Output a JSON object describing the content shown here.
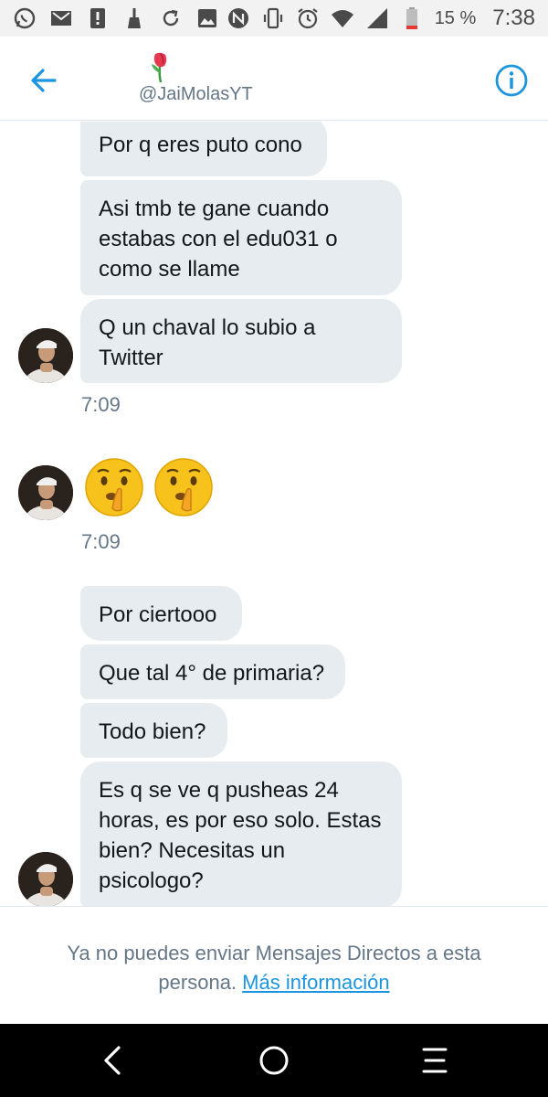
{
  "status_bar": {
    "battery_percent": "15 %",
    "time": "7:38",
    "left_icons": [
      "whatsapp-icon",
      "gmail-icon",
      "alert-icon",
      "broom-icon",
      "sync-icon",
      "gallery-icon"
    ],
    "right_icons": [
      "nfc-icon",
      "vibrate-icon",
      "alarm-icon",
      "wifi-icon",
      "signal-icon",
      "battery-icon"
    ]
  },
  "header": {
    "handle": "@JaiMolasYT",
    "back_icon": "back-arrow-icon",
    "info_icon": "info-icon",
    "accent_color": "#1b95e0"
  },
  "messages": [
    {
      "group": 1,
      "text": "Por q eres puto cono"
    },
    {
      "group": 1,
      "text": "Asi tmb te gane cuando estabas con el edu031 o como se llame"
    },
    {
      "group": 1,
      "text": "Q un chaval lo subio a Twitter"
    },
    {
      "group": 1,
      "time": "7:09"
    },
    {
      "group": 2,
      "emoji": [
        "shushing-face-emoji",
        "shushing-face-emoji"
      ]
    },
    {
      "group": 2,
      "time": "7:09"
    },
    {
      "group": 3,
      "text": "Por ciertooo"
    },
    {
      "group": 3,
      "text": "Que tal 4° de primaria?"
    },
    {
      "group": 3,
      "text": "Todo bien?"
    },
    {
      "group": 3,
      "text": "Es q se ve q pusheas 24 horas, es por eso solo. Estas bien? Necesitas un psicologo?"
    }
  ],
  "footer": {
    "notice": "Ya no puedes enviar Mensajes Directos a esta persona.",
    "link": "Más información"
  },
  "nav_bar": {
    "icons": [
      "back-nav-icon",
      "home-nav-icon",
      "recents-nav-icon"
    ]
  }
}
